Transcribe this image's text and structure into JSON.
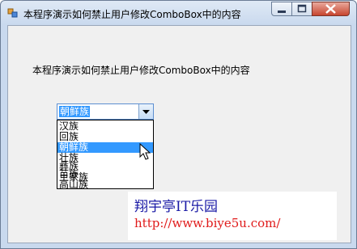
{
  "window": {
    "title": "本程序演示如何禁止用户修改ComboBox中的内容",
    "icon": "app-icon",
    "controls": {
      "minimize": "minimize-icon",
      "maximize": "maximize-icon",
      "close": "close-icon"
    }
  },
  "main": {
    "label": "本程序演示如何禁止用户修改ComboBox中的内容",
    "combo": {
      "selected": "朝鲜族",
      "options": [
        "汉族",
        "回族",
        "朝鲜族",
        "壮族",
        "彝族",
        "苗族",
        "土家族",
        "高山族"
      ],
      "highlighted_index": 2
    }
  },
  "watermark": {
    "line1": "翔宇亭IT乐园",
    "line2": "http://www.biye5u.com/"
  },
  "colors": {
    "selection": "#3399ff",
    "watermark_blue": "#1a1aa6",
    "watermark_red": "#e01b1b"
  }
}
